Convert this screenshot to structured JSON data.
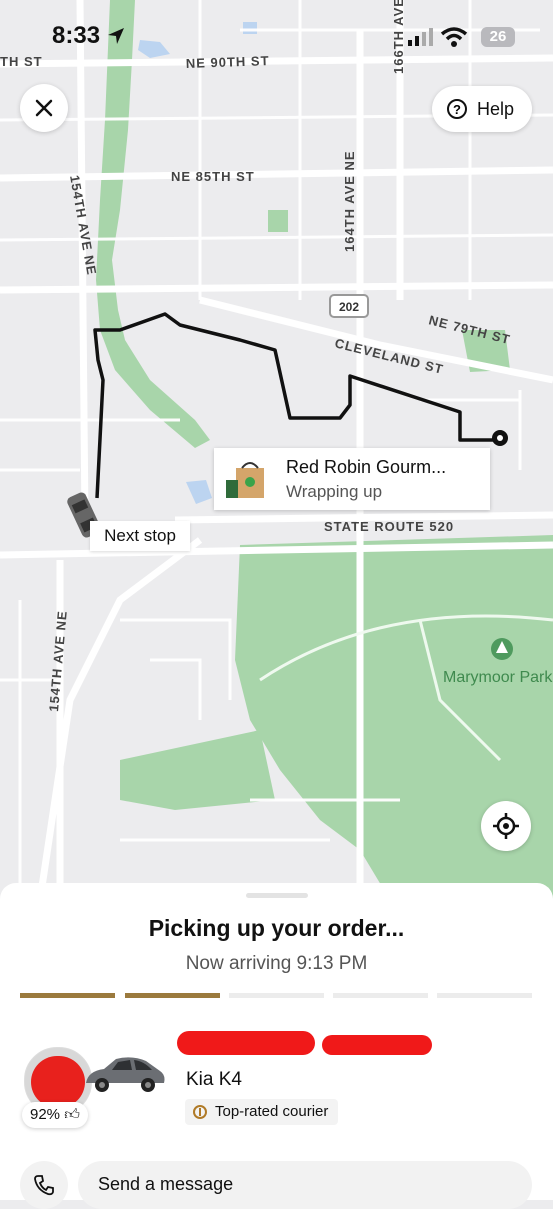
{
  "status_bar": {
    "time": "8:33",
    "battery": "26"
  },
  "map": {
    "streets": {
      "st_partial": "TH ST",
      "ne_90th": "NE 90TH ST",
      "ne_85th": "NE 85TH ST",
      "ave_154th_top": "154TH AVE NE",
      "ave_164th": "164TH AVE NE",
      "ave_166th": "166TH AVE",
      "route_202": "202",
      "ne_79th": "NE 79TH ST",
      "cleveland": "CLEVELAND ST",
      "sr_520": "STATE ROUTE 520",
      "ave_154th_bottom": "154TH AVE NE"
    },
    "park_label": "Marymoor Park",
    "next_stop_label": "Next stop",
    "store": {
      "name": "Red Robin Gourm...",
      "status": "Wrapping up"
    },
    "colors": {
      "route": "#111111",
      "park": "#a8d5aa",
      "road": "#ffffff"
    }
  },
  "top": {
    "help_label": "Help",
    "close_icon": "close-icon"
  },
  "order": {
    "title": "Picking up your order...",
    "eta": "Now arriving 9:13 PM",
    "progress_steps_total": 5,
    "progress_steps_done": 2,
    "accent": "#9b7a3d"
  },
  "courier": {
    "rating": "92%",
    "vehicle": "Kia K4",
    "badge": "Top-rated courier"
  },
  "actions": {
    "message_placeholder": "Send a message"
  }
}
